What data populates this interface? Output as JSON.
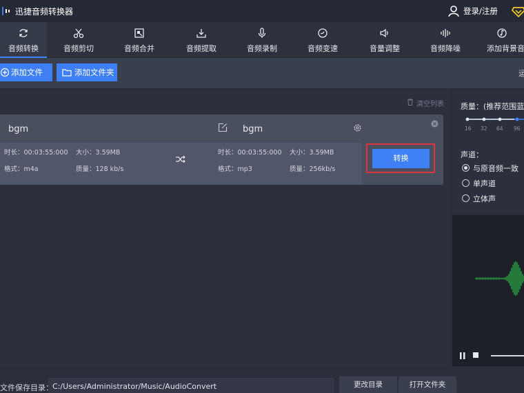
{
  "window": {
    "title": "迅捷音频转换器",
    "login_label": "登录/注册"
  },
  "nav": {
    "items": [
      {
        "label": "音频转换",
        "icon": "refresh-icon",
        "active": true
      },
      {
        "label": "音频剪切",
        "icon": "scissors-icon"
      },
      {
        "label": "音频合并",
        "icon": "merge-icon"
      },
      {
        "label": "音频提取",
        "icon": "extract-icon"
      },
      {
        "label": "音频录制",
        "icon": "microphone-icon"
      },
      {
        "label": "音频变速",
        "icon": "speed-icon"
      },
      {
        "label": "音量调整",
        "icon": "volume-icon"
      },
      {
        "label": "音频降噪",
        "icon": "denoise-icon"
      },
      {
        "label": "添加背景音",
        "icon": "music-note-icon"
      }
    ]
  },
  "toolbar": {
    "add_file": "添加文件",
    "add_folder": "添加文件夹",
    "tail_text": "运"
  },
  "list": {
    "clear_label": "清空列表"
  },
  "file": {
    "source_name": "bgm",
    "target_name": "bgm",
    "source": {
      "duration": "时长：00:03:55:000",
      "size": "大小：3.59MB",
      "format": "格式：m4a",
      "quality": "质量：128 kb/s"
    },
    "target": {
      "duration": "时长：00:03:55:000",
      "size": "大小：3.59MB",
      "format": "格式：mp3",
      "quality": "质量：256kb/s"
    },
    "convert_label": "转换"
  },
  "settings": {
    "quality_label": "质量：(推荐范围蓝",
    "quality_ticks": [
      "16",
      "32",
      "64",
      "96"
    ],
    "channel_label": "声道：",
    "channel_options": [
      "与原音频一致",
      "单声道",
      "立体声"
    ],
    "selected_channel": 0
  },
  "colors": {
    "accent": "#3e82f7",
    "waveform": "#29c34a",
    "highlight": "#e0343c"
  },
  "bottom": {
    "save_dir_label": "文件保存目录：",
    "save_path": "C:/Users/Administrator/Music/AudioConvert",
    "change_dir": "更改目录",
    "open_folder": "打开文件夹"
  }
}
